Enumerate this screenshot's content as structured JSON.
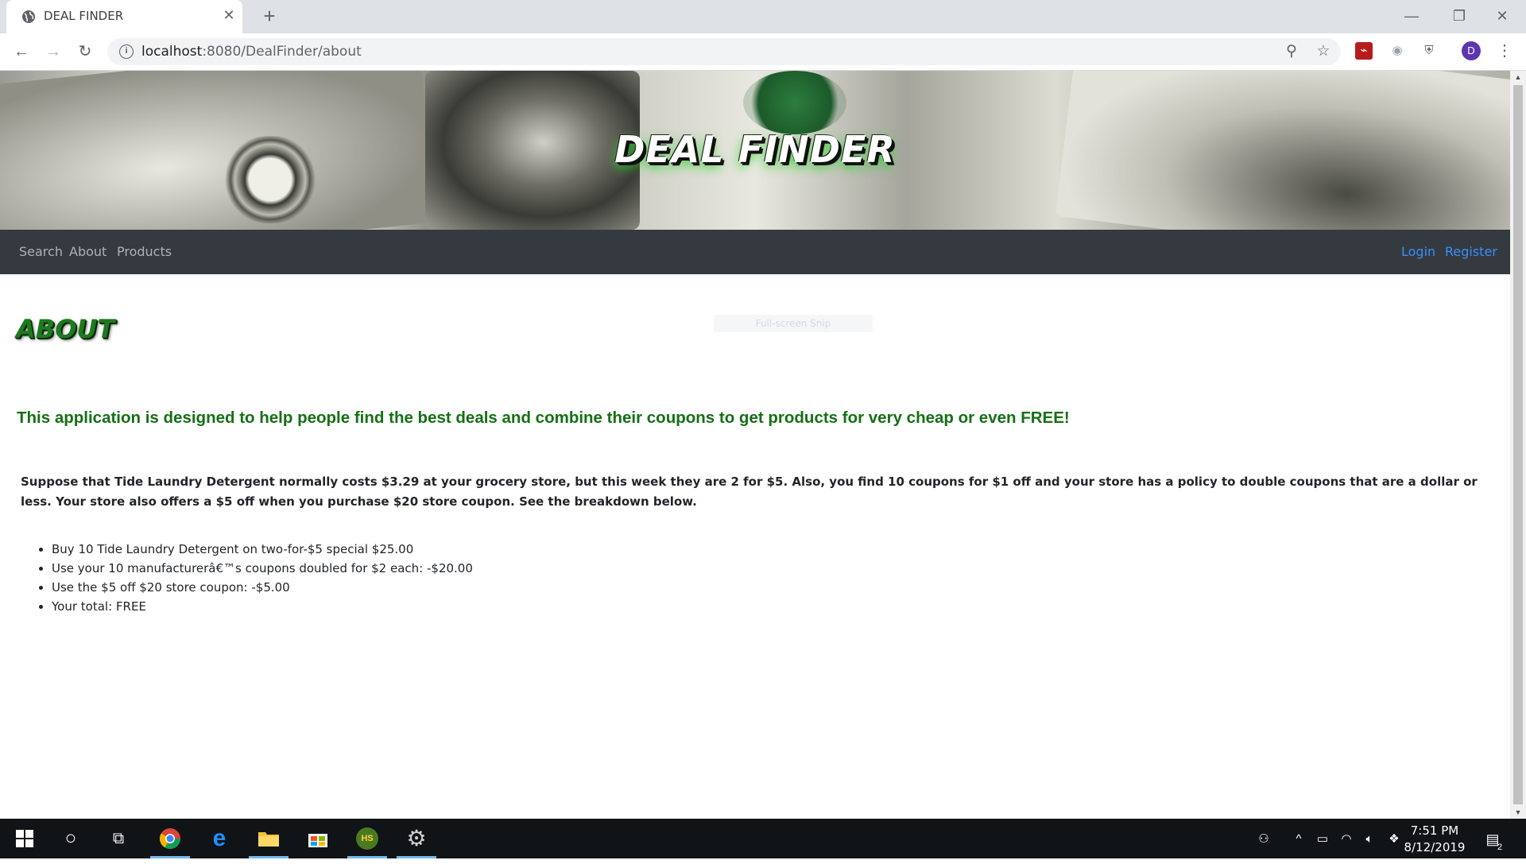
{
  "browser": {
    "tab_title": "DEAL FINDER",
    "new_tab_symbol": "+",
    "url_host": "localhost",
    "url_path": ":8080/DealFinder/about",
    "profile_initial": "D"
  },
  "site": {
    "banner_title": "DEAL FINDER",
    "nav": {
      "search": "Search",
      "about": "About",
      "products": "Products"
    },
    "auth": {
      "login": "Login",
      "register": "Register"
    }
  },
  "content": {
    "heading": "ABOUT",
    "overlay_text": "Full-screen Snip",
    "lead": "This application is designed to help people find the best deals and combine their coupons to get products for very cheap or even FREE!",
    "scenario": "Suppose that Tide Laundry Detergent normally costs $3.29 at your grocery store, but this week they are 2 for $5. Also, you find 10 coupons for $1 off and your store has a policy to double coupons that are a dollar or less. Your store also offers a $5 off when you purchase $20 store coupon. See the breakdown below.",
    "breakdown": [
      "Buy 10 Tide Laundry Detergent on two-for-$5 special $25.00",
      "Use your 10 manufacturerâ€™s coupons doubled for $2 each: -$20.00",
      "Use the $5 off $20 store coupon: -$5.00",
      "Your total: FREE"
    ]
  },
  "taskbar": {
    "time": "7:51 PM",
    "date": "8/12/2019",
    "notification_count": "2"
  },
  "colors": {
    "nav_bg": "#343a40",
    "auth_link": "#3b8ef6",
    "heading_green": "#1e7a1e",
    "lead_green": "#147014"
  }
}
